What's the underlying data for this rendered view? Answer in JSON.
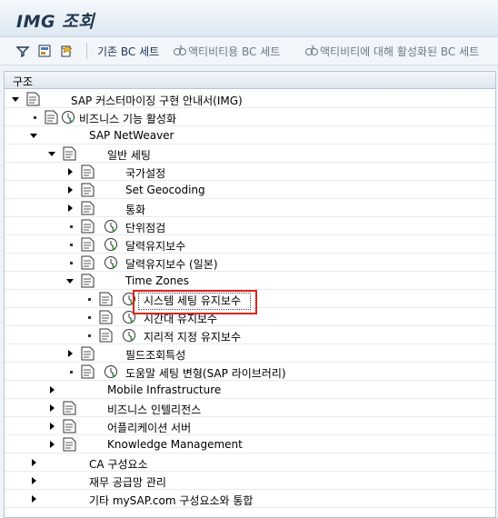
{
  "window": {
    "title": "IMG 조회"
  },
  "toolbar": {
    "icons": [
      "filter-icon",
      "info-icon",
      "favorites-icon"
    ],
    "btn1": "기존 BC 세트",
    "btn2": "액티비티용 BC 세트",
    "btn3": "액티비티에 대해 활성화된 BC 세트"
  },
  "tree": {
    "column_header": "구조",
    "rows": [
      {
        "label": "SAP 커스터마이징 구현 안내서(IMG)"
      },
      {
        "label": "비즈니스 기능 활성화"
      },
      {
        "label": "SAP NetWeaver"
      },
      {
        "label": "일반 세팅"
      },
      {
        "label": "국가설정"
      },
      {
        "label": "Set Geocoding"
      },
      {
        "label": "통화"
      },
      {
        "label": "단위점검"
      },
      {
        "label": "달력유지보수"
      },
      {
        "label": "달력유지보수 (일본)"
      },
      {
        "label": "Time Zones"
      },
      {
        "label": "시스템 세팅 유지보수"
      },
      {
        "label": "시간대 유지보수"
      },
      {
        "label": "지리적 지정 유지보수"
      },
      {
        "label": "필드조회특성"
      },
      {
        "label": "도움말 세팅 변형(SAP 라이브러리)"
      },
      {
        "label": "Mobile Infrastructure"
      },
      {
        "label": "비즈니스 인텔리전스"
      },
      {
        "label": "어플리케이션 서버"
      },
      {
        "label": "Knowledge Management"
      },
      {
        "label": "CA 구성요소"
      },
      {
        "label": "재무 공급망 관리"
      },
      {
        "label": "기타 mySAP.com 구성요소와 통합"
      }
    ]
  },
  "colors": {
    "highlight": "#e0231a",
    "clock_green": "#2e9b2e"
  }
}
